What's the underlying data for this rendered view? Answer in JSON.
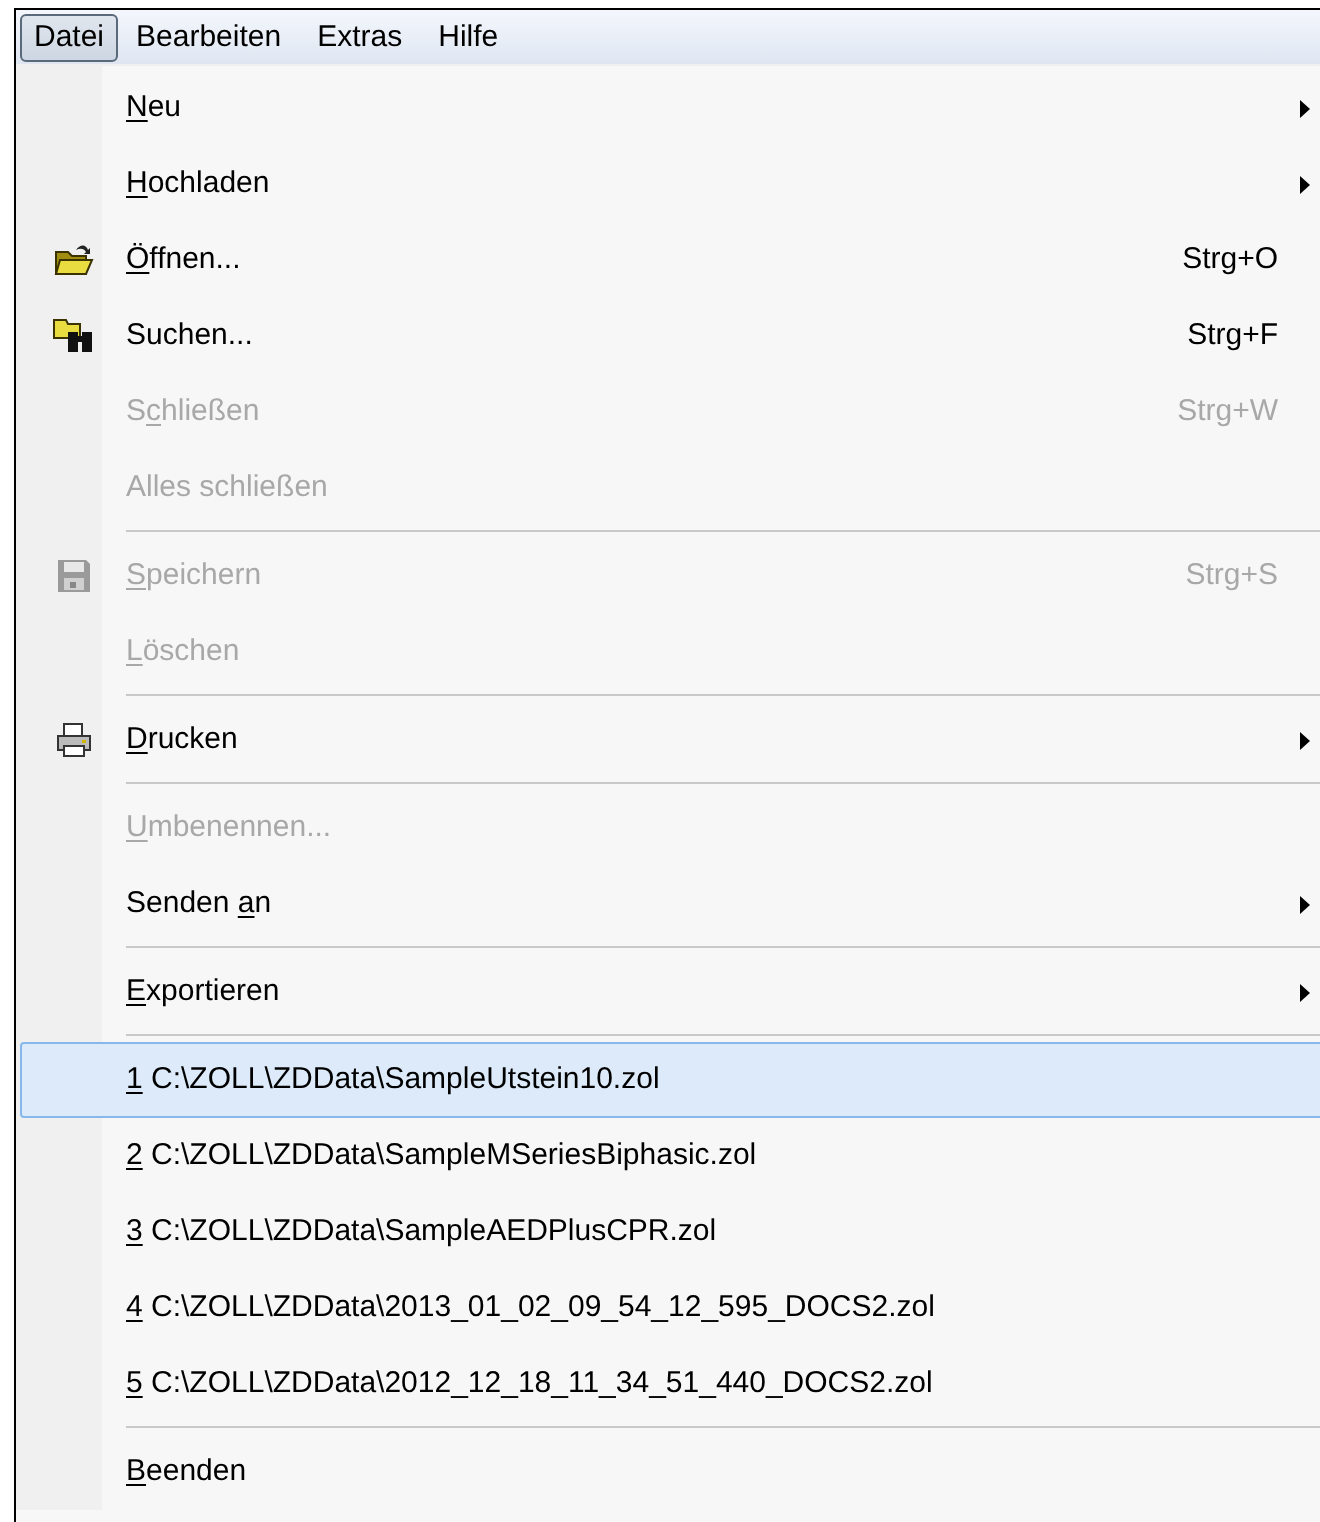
{
  "menubar": [
    {
      "label": {
        "text": "Datei"
      },
      "selected": true
    },
    {
      "label": {
        "text": "Bearbeiten"
      },
      "selected": false
    },
    {
      "label": {
        "text": "Extras"
      },
      "selected": false
    },
    {
      "label": {
        "text": "Hilfe"
      },
      "selected": false
    }
  ],
  "menu": [
    {
      "kind": "item",
      "label": {
        "key": "N",
        "after": "eu"
      },
      "disabled": false,
      "submenu": true
    },
    {
      "kind": "item",
      "label": {
        "key": "H",
        "after": "ochladen"
      },
      "disabled": false,
      "submenu": true
    },
    {
      "kind": "item",
      "label": {
        "key": "Ö",
        "after": "ffnen..."
      },
      "shortcut": "Strg+O",
      "disabled": false
    },
    {
      "kind": "item",
      "label": {
        "text": "Suchen..."
      },
      "shortcut": "Strg+F",
      "disabled": false
    },
    {
      "kind": "item",
      "label": {
        "before": "S",
        "key": "c",
        "after": "hließen"
      },
      "shortcut": "Strg+W",
      "disabled": true
    },
    {
      "kind": "item",
      "label": {
        "text": "Alles schließen"
      },
      "disabled": true
    },
    {
      "kind": "separator"
    },
    {
      "kind": "item",
      "label": {
        "key": "S",
        "after": "peichern"
      },
      "shortcut": "Strg+S",
      "disabled": true
    },
    {
      "kind": "item",
      "label": {
        "key": "L",
        "after": "öschen"
      },
      "disabled": true
    },
    {
      "kind": "separator"
    },
    {
      "kind": "item",
      "label": {
        "key": "D",
        "after": "rucken"
      },
      "disabled": false,
      "submenu": true
    },
    {
      "kind": "separator"
    },
    {
      "kind": "item",
      "label": {
        "key": "U",
        "after": "mbenennen..."
      },
      "disabled": true
    },
    {
      "kind": "item",
      "label": {
        "before": "Senden ",
        "key": "a",
        "after": "n"
      },
      "disabled": false,
      "submenu": true
    },
    {
      "kind": "separator"
    },
    {
      "kind": "item",
      "label": {
        "key": "E",
        "after": "xportieren"
      },
      "disabled": false,
      "submenu": true
    },
    {
      "kind": "separator"
    },
    {
      "kind": "item",
      "label": {
        "key": "1",
        "after": " C:\\ZOLL\\ZDData\\SampleUtstein10.zol"
      },
      "disabled": false,
      "selected": true
    },
    {
      "kind": "item",
      "label": {
        "key": "2",
        "after": " C:\\ZOLL\\ZDData\\SampleMSeriesBiphasic.zol"
      },
      "disabled": false,
      "selected": false
    },
    {
      "kind": "item",
      "label": {
        "key": "3",
        "after": " C:\\ZOLL\\ZDData\\SampleAEDPlusCPR.zol"
      },
      "disabled": false,
      "selected": false
    },
    {
      "kind": "item",
      "label": {
        "key": "4",
        "after": " C:\\ZOLL\\ZDData\\2013_01_02_09_54_12_595_DOCS2.zol"
      },
      "disabled": false,
      "selected": false
    },
    {
      "kind": "item",
      "label": {
        "key": "5",
        "after": " C:\\ZOLL\\ZDData\\2012_12_18_11_34_51_440_DOCS2.zol"
      },
      "disabled": false,
      "selected": false
    },
    {
      "kind": "separator"
    },
    {
      "kind": "item",
      "label": {
        "key": "B",
        "after": "eenden"
      },
      "disabled": false
    }
  ]
}
